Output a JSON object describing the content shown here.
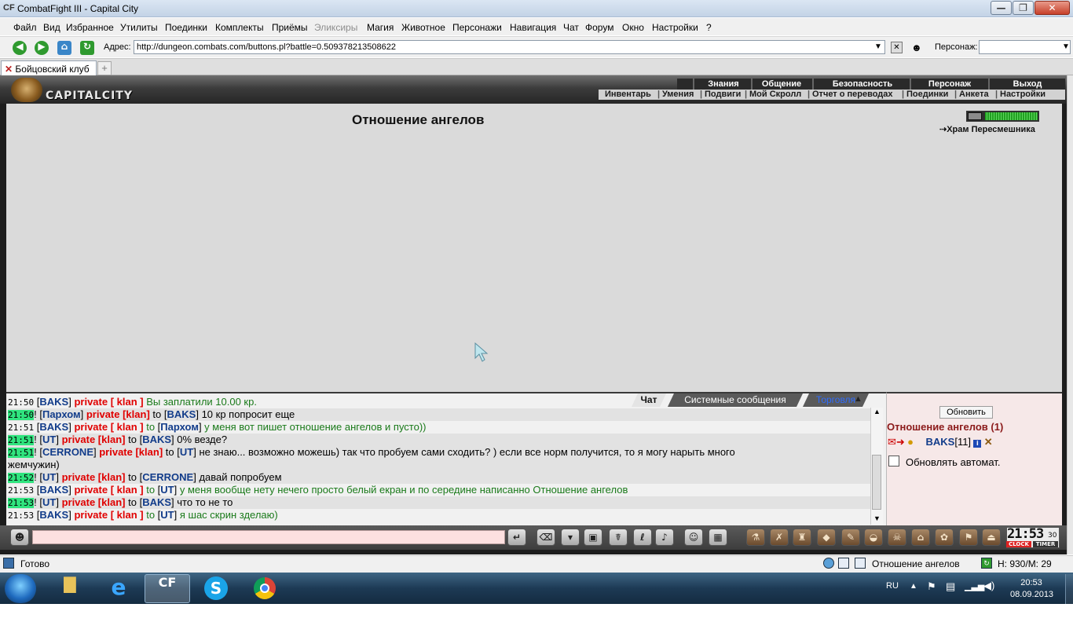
{
  "window": {
    "icon": "cf-app-icon",
    "title": "CombatFight III - Capital City",
    "minimize": "—",
    "maximize": "❐",
    "close": "✕"
  },
  "menu": [
    {
      "label": "Файл",
      "disabled": false
    },
    {
      "label": "Вид",
      "disabled": false
    },
    {
      "label": "Избранное",
      "disabled": false
    },
    {
      "label": "Утилиты",
      "disabled": false
    },
    {
      "label": "Поединки",
      "disabled": false
    },
    {
      "label": "Комплекты",
      "disabled": false
    },
    {
      "label": "Приёмы",
      "disabled": false
    },
    {
      "label": "Эликсиры",
      "disabled": true
    },
    {
      "label": "Магия",
      "disabled": false
    },
    {
      "label": "Животное",
      "disabled": false
    },
    {
      "label": "Персонажи",
      "disabled": false
    },
    {
      "label": "Навигация",
      "disabled": false
    },
    {
      "label": "Чат",
      "disabled": false
    },
    {
      "label": "Форум",
      "disabled": false
    },
    {
      "label": "Окно",
      "disabled": false
    },
    {
      "label": "Настройки",
      "disabled": false
    },
    {
      "label": "?",
      "disabled": false
    }
  ],
  "address": {
    "label": "Адрес:",
    "url": "http://dungeon.combats.com/buttons.pl?battle=0.509378213508622",
    "character_label": "Персонаж:",
    "character_value": ""
  },
  "tabs": {
    "active": "Бойцовский клуб",
    "new_tab": "+"
  },
  "game": {
    "logo_text": "CAPITALCITY",
    "top_tabs": [
      "Знания",
      "Общение",
      "Безопасность",
      "Персонаж",
      "Выход"
    ],
    "sub_tabs": [
      "Инвентарь",
      "Умения",
      "Подвиги",
      "Мой Скролл",
      "Отчет о переводах",
      "Поединки",
      "Анкета",
      "Настройки"
    ],
    "heading": "Отношение ангелов",
    "temple_link": "Храм Пересмешника",
    "hp_fill_fraction": 1.0
  },
  "chat": {
    "tabs": [
      "Чат",
      "Системные сообщения",
      "Торговля"
    ],
    "lines": [
      {
        "time": "21:50",
        "hl": false,
        "pre": "",
        "from": "BAKS",
        "priv": "private [ klan ]",
        "to": "",
        "text": "Вы заплатили 10.00 кр.",
        "green": true,
        "bg": false
      },
      {
        "time": "21:50",
        "hl": true,
        "pre": "! ",
        "from": "Пархом",
        "priv": "private [klan]",
        "to": "BAKS",
        "text": "10 кр попросит еще",
        "green": false,
        "bg": true
      },
      {
        "time": "21:51",
        "hl": false,
        "pre": "",
        "from": "BAKS",
        "priv": "private [ klan ]",
        "to": "Пархом",
        "text": "у меня вот пишет отношение ангелов и пусто))",
        "green": true,
        "bg": false
      },
      {
        "time": "21:51",
        "hl": true,
        "pre": "! ",
        "from": "UT",
        "priv": "private [klan]",
        "to": "BAKS",
        "text": "0% везде?",
        "green": false,
        "bg": true
      },
      {
        "time": "21:51",
        "hl": true,
        "pre": "! ",
        "from": "CERRONE",
        "priv": "private [klan]",
        "to": "UT",
        "text": "не знаю... возможно можешь) так что пробуем сами сходить? ) если все норм получится, то я могу нарыть много",
        "green": false,
        "bg": true
      },
      {
        "time": "",
        "hl": false,
        "pre": "",
        "from": "",
        "priv": "",
        "to": "",
        "text": "жемчужин)",
        "green": false,
        "bg": true
      },
      {
        "time": "21:52",
        "hl": true,
        "pre": "! ",
        "from": "UT",
        "priv": "private [klan]",
        "to": "CERRONE",
        "text": "давай попробуем",
        "green": false,
        "bg": true
      },
      {
        "time": "21:53",
        "hl": false,
        "pre": "",
        "from": "BAKS",
        "priv": "private [ klan ]",
        "to": "UT",
        "text": "у меня вообще нету нечего просто белый екран и по середине написанно Отношение ангелов",
        "green": true,
        "bg": false
      },
      {
        "time": "21:53",
        "hl": true,
        "pre": "! ",
        "from": "UT",
        "priv": "private [klan]",
        "to": "BAKS",
        "text": "что то не то",
        "green": false,
        "bg": true
      },
      {
        "time": "21:53",
        "hl": false,
        "pre": "",
        "from": "BAKS",
        "priv": "private [ klan ]",
        "to": "UT",
        "text": "я шас скрин зделаю)",
        "green": true,
        "bg": false
      }
    ],
    "input_value": ""
  },
  "side": {
    "refresh": "Обновить",
    "room_title": "Отношение ангелов (1)",
    "player_name": "BAKS",
    "player_level": "[11]",
    "auto_refresh_label": "Обновлять автомат."
  },
  "toolbar_icons": [
    "chat-speaker-icon",
    "enter-icon",
    "clear-icon",
    "filter-icon",
    "save-icon",
    "run-icon",
    "translit-icon",
    "sound-icon",
    "smile-icon",
    "trash-icon",
    "potion-icon",
    "sword-icon",
    "bag-icon",
    "treasure-icon",
    "scroll-icon",
    "helmet-icon",
    "skull-icon",
    "house-icon",
    "paw-icon",
    "flag-icon",
    "exit-icon"
  ],
  "clock": {
    "time": "21:53",
    "seconds": "30",
    "clock_label": "CLOCK",
    "timer_label": "TIMER"
  },
  "status": {
    "ready": "Готово",
    "page": "Отношение ангелов",
    "hm": "H: 930/M: 29"
  },
  "taskbar": {
    "lang": "RU",
    "time": "20:53",
    "date": "08.09.2013"
  },
  "colors": {
    "nick": "#123c8a",
    "private": "#e00000",
    "system_green": "#1a7a1a",
    "highlight": "#2fe47e",
    "room_title": "#8b1a1a"
  }
}
